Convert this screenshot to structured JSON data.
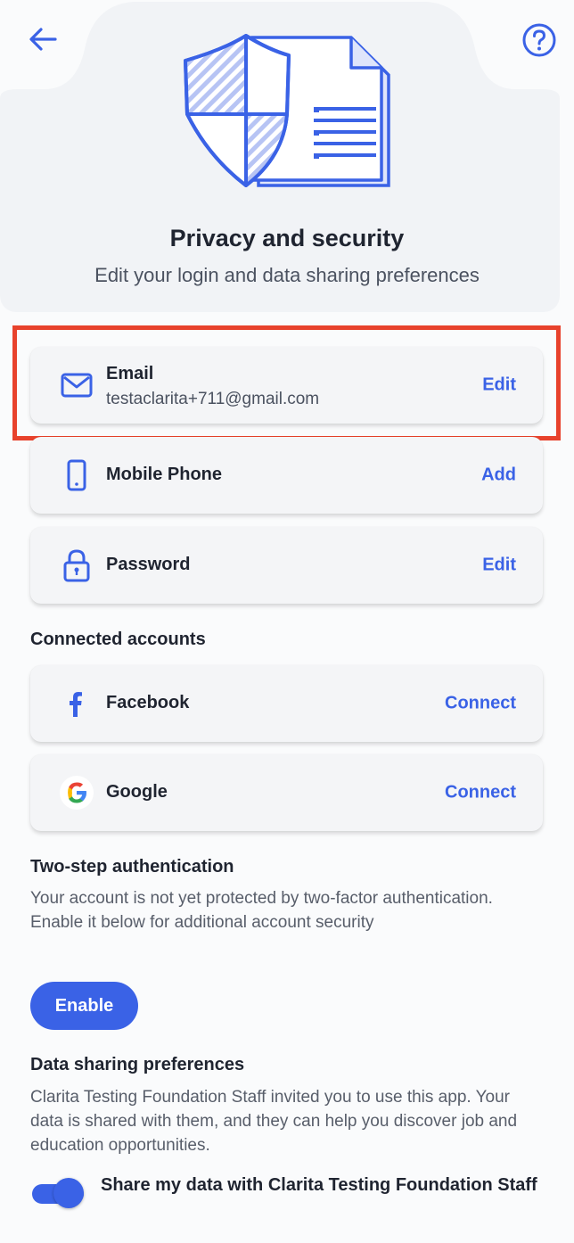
{
  "header": {
    "title": "Privacy and security",
    "subtitle": "Edit your login and data sharing preferences"
  },
  "login_items": [
    {
      "label": "Email",
      "value": "testaclarita+711@gmail.com",
      "action": "Edit",
      "icon": "mail-icon"
    },
    {
      "label": "Mobile Phone",
      "value": "",
      "action": "Add",
      "icon": "phone-icon"
    },
    {
      "label": "Password",
      "value": "",
      "action": "Edit",
      "icon": "lock-icon"
    }
  ],
  "connected_accounts": {
    "title": "Connected accounts",
    "items": [
      {
        "label": "Facebook",
        "action": "Connect",
        "icon": "facebook-icon"
      },
      {
        "label": "Google",
        "action": "Connect",
        "icon": "google-icon"
      }
    ]
  },
  "two_step": {
    "title": "Two-step authentication",
    "description": "Your account is not yet protected by two-factor authentication. Enable it below for additional account security",
    "button": "Enable"
  },
  "data_sharing": {
    "title": "Data sharing preferences",
    "description": "Clarita Testing Foundation Staff invited you to use this app. Your data is shared with them, and they can help you discover job and education opportunities.",
    "toggle_label": "Share my data with Clarita Testing Foundation Staff",
    "toggle_on": true
  },
  "colors": {
    "accent": "#3a62e6",
    "highlight": "#e8422c"
  }
}
